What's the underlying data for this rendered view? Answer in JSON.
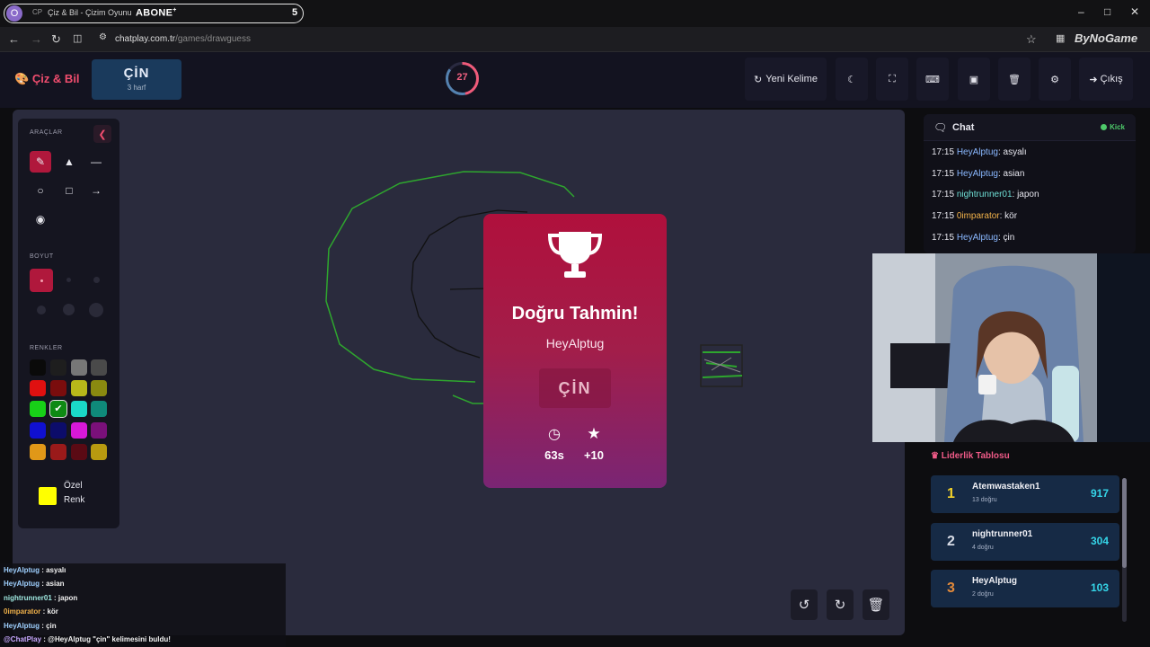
{
  "browser": {
    "profile_initial": "O",
    "tab_title": "Çiz & Bil - Çizim Oyunu",
    "tab_overlay_label": "ABONE",
    "tab_overlay_count": "5",
    "url_host": "chatplay.com.tr",
    "url_path": "/games/drawguess",
    "extension_label": "ByNoGame"
  },
  "header": {
    "logo": "Çiz & Bil",
    "word": "ÇİN",
    "word_hint": "3 harf",
    "timer_value": "27",
    "timer_fraction_remaining": 0.85,
    "new_word_label": "Yeni Kelime",
    "exit_label": "Çıkış"
  },
  "tools": {
    "tools_label": "ARAÇLAR",
    "size_label": "BOYUT",
    "colors_label": "RENKLER",
    "custom_color_label_1": "Özel",
    "custom_color_label_2": "Renk",
    "custom_color": "#ffff00",
    "selected_color": "#0e8a14",
    "palette": [
      "#0a0a0a",
      "#1e1e1e",
      "#777777",
      "#4a4a4a",
      "#e01010",
      "#7a0d0d",
      "#b8b81a",
      "#8a8a10",
      "#18d018",
      "#0e8a14",
      "#1ad8c8",
      "#0f8a7a",
      "#1010d0",
      "#0c0c6a",
      "#d818d8",
      "#7a107a",
      "#e09818",
      "#9a1a1a",
      "#5a0a14",
      "#b89a10"
    ]
  },
  "modal": {
    "title": "Doğru Tahmin!",
    "player": "HeyAlptug",
    "word": "ÇİN",
    "time": "63s",
    "points": "+10"
  },
  "overlay_chat": [
    {
      "user": "HeyAlptug",
      "text": " : asyalı"
    },
    {
      "user": "HeyAlptug",
      "text": " : asian"
    },
    {
      "user": "nightrunner01",
      "text": " : japon"
    },
    {
      "user": "0imparator",
      "text": " : kör"
    },
    {
      "user": "HeyAlptug",
      "text": " : çin"
    },
    {
      "user": "@ChatPlay",
      "text": " : @HeyAlptug \"çin\" kelimesini buldu!"
    }
  ],
  "chat": {
    "title": "Chat",
    "status": "Kick",
    "messages": [
      {
        "time": "17:15",
        "user": "HeyAlptug",
        "text": ": asyalı"
      },
      {
        "time": "17:15",
        "user": "HeyAlptug",
        "text": ": asian"
      },
      {
        "time": "17:15",
        "user": "nightrunner01",
        "text": ": japon"
      },
      {
        "time": "17:15",
        "user": "0imparator",
        "text": ": kör"
      },
      {
        "time": "17:15",
        "user": "HeyAlptug",
        "text": ": çin"
      }
    ]
  },
  "leaderboard": {
    "title": "Liderlik Tablosu",
    "rows": [
      {
        "rank": "1",
        "name": "Atemwastaken1",
        "sub": "13 doğru",
        "score": "917",
        "color": "#f2d12a"
      },
      {
        "rank": "2",
        "name": "nightrunner01",
        "sub": "4 doğru",
        "score": "304",
        "color": "#d8dce6"
      },
      {
        "rank": "3",
        "name": "HeyAlptug",
        "sub": "2 doğru",
        "score": "103",
        "color": "#e38a3a"
      }
    ]
  }
}
